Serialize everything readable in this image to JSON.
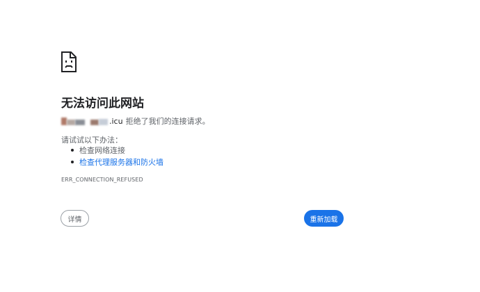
{
  "error": {
    "icon": "sad-document-icon",
    "headline": "无法访问此网站",
    "hostname": ".icu",
    "reason": "拒绝了我们的连接请求。",
    "suggestions_title": "请试试以下办法：",
    "suggestions": [
      {
        "label": "检查网络连接",
        "is_link": false
      },
      {
        "label": "检查代理服务器和防火墙",
        "is_link": true
      }
    ],
    "error_code": "ERR_CONNECTION_REFUSED"
  },
  "buttons": {
    "details_label": "详情",
    "reload_label": "重新加载"
  },
  "colors": {
    "accent": "#1a73e8",
    "text": "#202124",
    "secondary_text": "#5f6368",
    "border": "#9aa0a6"
  }
}
